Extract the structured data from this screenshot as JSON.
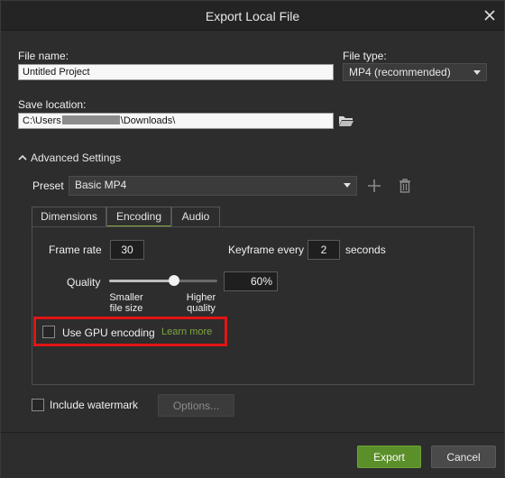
{
  "dialog": {
    "title": "Export Local File",
    "close_icon": "close-icon"
  },
  "file_name": {
    "label": "File name:",
    "value": "Untitled Project"
  },
  "file_type": {
    "label": "File type:",
    "value": "MP4 (recommended)"
  },
  "save_location": {
    "label": "Save location:",
    "value_prefix": "C:\\Users",
    "value_suffix": "\\Downloads\\",
    "browse_icon": "folder-open-icon"
  },
  "advanced": {
    "toggle_label": "Advanced Settings",
    "preset_label": "Preset",
    "preset_value": "Basic MP4",
    "add_icon": "plus-icon",
    "delete_icon": "trash-icon",
    "tabs": [
      {
        "label": "Dimensions",
        "active": false
      },
      {
        "label": "Encoding",
        "active": true
      },
      {
        "label": "Audio",
        "active": false
      }
    ],
    "frame_rate_label": "Frame rate",
    "frame_rate_value": "30",
    "keyframe_label": "Keyframe every",
    "keyframe_value": "2",
    "keyframe_unit": "seconds",
    "quality_label": "Quality",
    "quality_value": "60%",
    "quality_fraction": 0.6,
    "quality_low_line1": "Smaller",
    "quality_low_line2": "file size",
    "quality_high_line1": "Higher",
    "quality_high_line2": "quality",
    "gpu_label": "Use GPU encoding",
    "gpu_checked": false,
    "gpu_link": "Learn more"
  },
  "watermark": {
    "label": "Include watermark",
    "checked": false,
    "options_label": "Options..."
  },
  "footer": {
    "export_label": "Export",
    "cancel_label": "Cancel"
  },
  "colors": {
    "accent": "#7da83f",
    "export_button": "#5a8f29",
    "highlight": "#e01515"
  }
}
